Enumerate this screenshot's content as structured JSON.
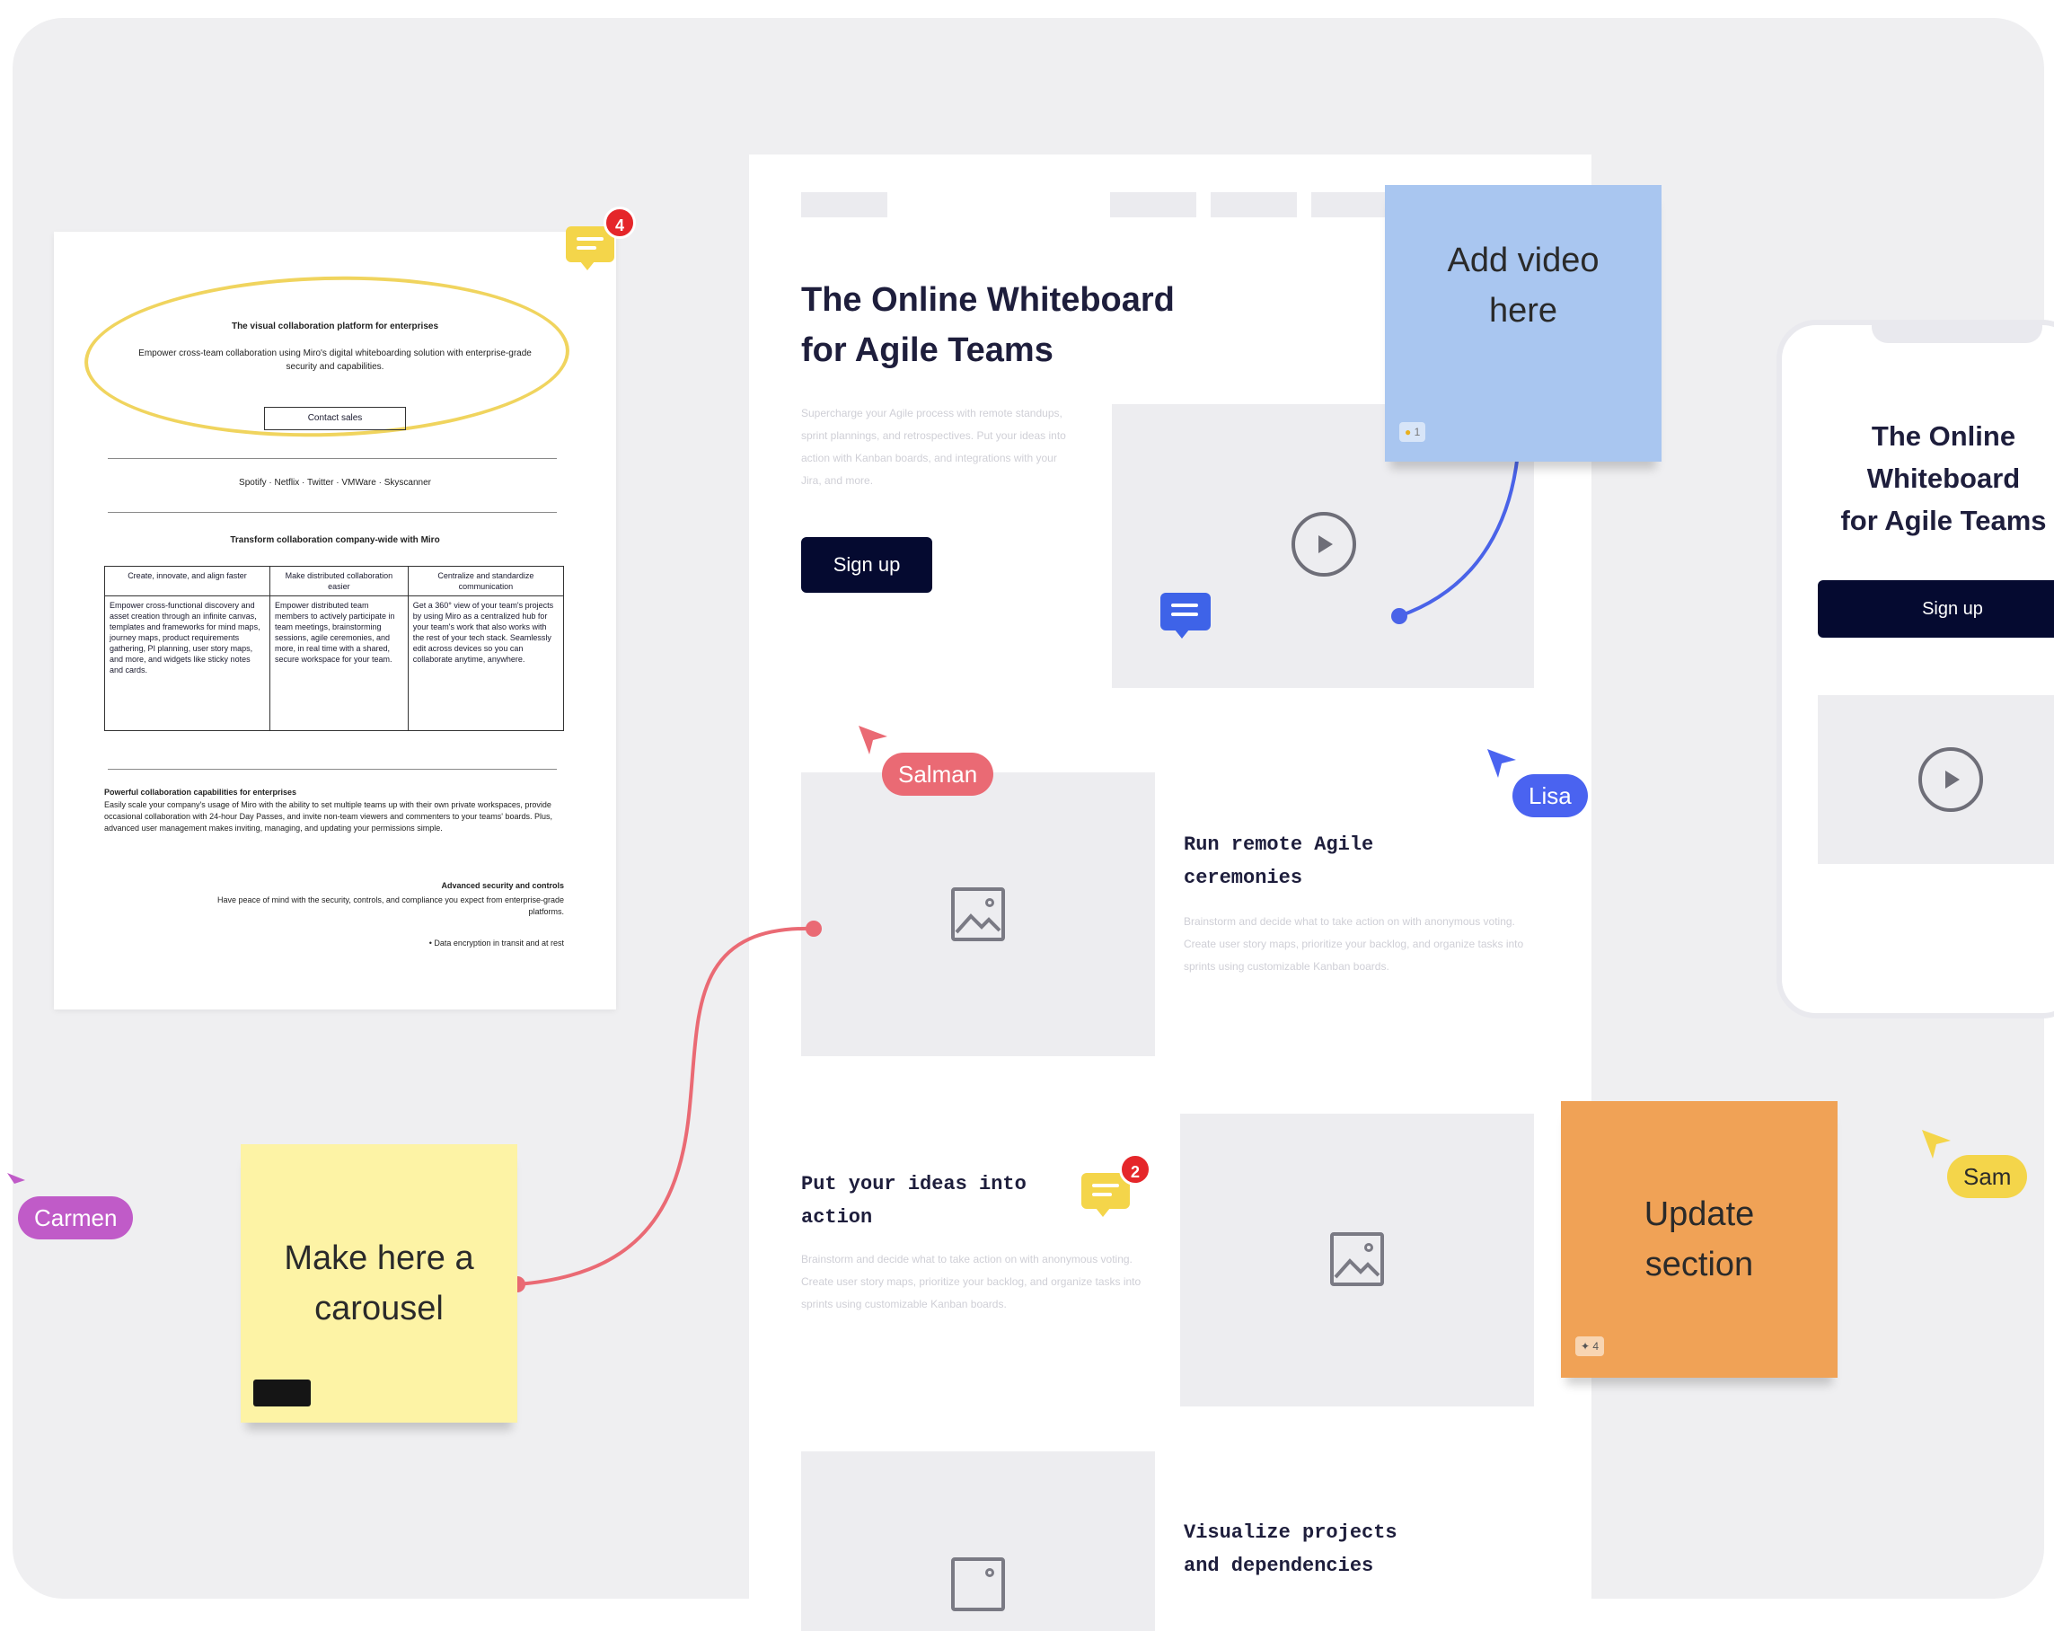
{
  "doc": {
    "title": "The visual collaboration platform for enterprises",
    "subtitle": "Empower cross-team collaboration using Miro's digital whiteboarding solution with enterprise-grade security and capabilities.",
    "button": "Contact sales",
    "logos": "Spotify · Netflix · Twitter · VMWare · Skyscanner",
    "section_title": "Transform collaboration company-wide with Miro",
    "table": {
      "headers": [
        "Create, innovate, and align faster",
        "Make distributed collaboration easier",
        "Centralize and standardize communication"
      ],
      "cells": [
        "Empower cross-functional discovery and asset creation through an infinite canvas, templates and frameworks for mind maps, journey maps, product requirements gathering, PI planning, user story maps, and more, and widgets like sticky notes and cards.",
        "Empower distributed team members to actively participate in team meetings, brainstorming sessions, agile ceremonies, and more, in real time with a shared, secure workspace for your team.",
        "Get a 360° view of your team's projects by using Miro as a centralized hub for your team's work that also works with the rest of your tech stack. Seamlessly edit across devices so you can collaborate anytime, anywhere."
      ]
    },
    "para1_title": "Powerful collaboration capabilities for enterprises",
    "para1": "Easily scale your company's usage of Miro with the ability to set multiple teams up with their own private workspaces, provide occasional collaboration with 24-hour Day Passes, and invite non-team viewers and commenters to your teams' boards. Plus, advanced user management makes inviting, managing, and updating your permissions simple.",
    "para2_title": "Advanced security and controls",
    "para2": "Have peace of mind with the security, controls, and compliance you expect from enterprise-grade platforms.",
    "para3": "• Data encryption in transit and at rest",
    "comment_count": "4"
  },
  "site": {
    "hero_title_line1": "The Online Whiteboard",
    "hero_title_line2": "for Agile Teams",
    "hero_text": "Supercharge your Agile process with remote standups, sprint plannings, and retrospectives. Put your ideas into action with Kanban boards, and integrations with your Jira, and more.",
    "signup": "Sign up",
    "feature1_title_line1": "Run remote Agile",
    "feature1_title_line2": "ceremonies",
    "feature1_text": "Brainstorm and decide what to take action on with anonymous voting. Create user story maps, prioritize your backlog, and organize tasks into sprints using customizable Kanban boards.",
    "feature2_title_line1": "Put your ideas into",
    "feature2_title_line2": "action",
    "feature2_text": "Brainstorm and decide what to take action on with anonymous voting. Create user story maps, prioritize your backlog, and organize tasks into sprints using customizable Kanban boards.",
    "feature2_comment_count": "2",
    "feature3_title_line1": "Visualize projects",
    "feature3_title_line2": "and dependencies"
  },
  "phone": {
    "title_line1": "The Online",
    "title_line2": "Whiteboard",
    "title_line3": "for Agile Teams",
    "signup": "Sign up"
  },
  "stickies": {
    "video_line1": "Add video",
    "video_line2": "here",
    "video_votes": "1",
    "carousel_line1": "Make here a",
    "carousel_line2": "carousel",
    "update_line1": "Update",
    "update_line2": "section",
    "update_votes": "4"
  },
  "cursors": {
    "salman": "Salman",
    "lisa": "Lisa",
    "carmen": "Carmen",
    "sam": "Sam"
  },
  "colors": {
    "board_bg": "#efeff1",
    "navy": "#050a30",
    "sticky_blue": "#a9c6f0",
    "sticky_yellow": "#fdf3a5",
    "sticky_orange": "#f0a256",
    "salman": "#ea6a74",
    "lisa": "#4a63f0",
    "carmen": "#c05bc8",
    "sam": "#f4d54a",
    "comment_yellow": "#f4d54a",
    "comment_blue": "#3e63e8",
    "badge_red": "#e5262a"
  }
}
